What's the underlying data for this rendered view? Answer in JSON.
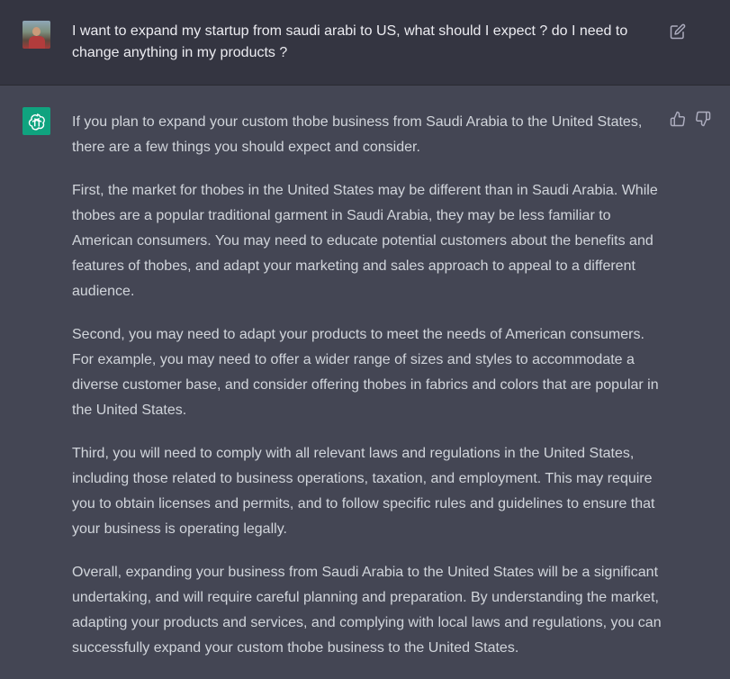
{
  "conversation": {
    "user_message": {
      "text": "I want to expand my startup from saudi arabi to US, what should I expect ? do I need to change anything in my products ?",
      "avatar_icon": "user-avatar-photo",
      "edit_icon": "edit-icon"
    },
    "assistant_message": {
      "avatar_icon": "openai-logo-icon",
      "avatar_color": "#10a37f",
      "paragraphs": [
        "If you plan to expand your custom thobe business from Saudi Arabia to the United States, there are a few things you should expect and consider.",
        "First, the market for thobes in the United States may be different than in Saudi Arabia. While thobes are a popular traditional garment in Saudi Arabia, they may be less familiar to American consumers. You may need to educate potential customers about the benefits and features of thobes, and adapt your marketing and sales approach to appeal to a different audience.",
        "Second, you may need to adapt your products to meet the needs of American consumers. For example, you may need to offer a wider range of sizes and styles to accommodate a diverse customer base, and consider offering thobes in fabrics and colors that are popular in the United States.",
        "Third, you will need to comply with all relevant laws and regulations in the United States, including those related to business operations, taxation, and employment. This may require you to obtain licenses and permits, and to follow specific rules and guidelines to ensure that your business is operating legally.",
        "Overall, expanding your business from Saudi Arabia to the United States will be a significant undertaking, and will require careful planning and preparation. By understanding the market, adapting your products and services, and complying with local laws and regulations, you can successfully expand your custom thobe business to the United States."
      ],
      "feedback_icons": [
        "thumbs-up-icon",
        "thumbs-down-icon"
      ]
    }
  },
  "colors": {
    "user_bg": "#343541",
    "assistant_bg": "#444654",
    "user_text": "#ececf1",
    "assistant_text": "#d1d5db",
    "icon": "#acacbe"
  }
}
